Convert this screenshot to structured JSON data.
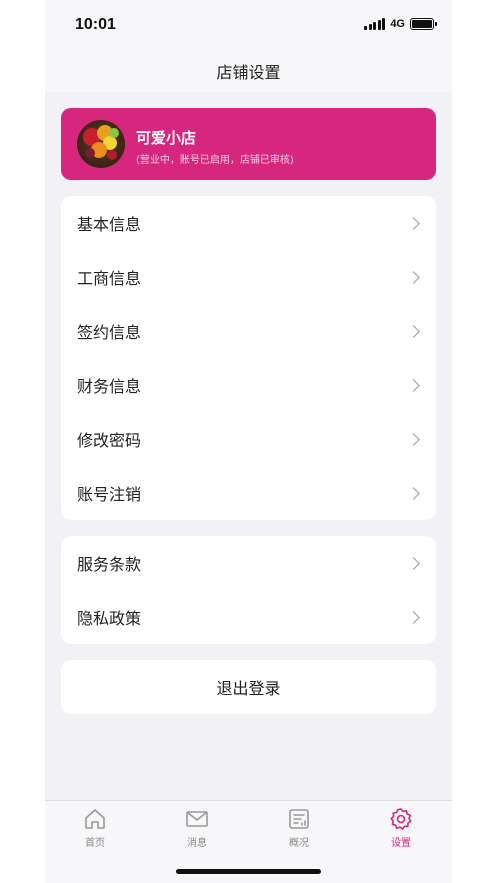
{
  "status_bar": {
    "time": "10:01",
    "network": "4G"
  },
  "header": {
    "title": "店铺设置"
  },
  "shop": {
    "name": "可爱小店",
    "status": "(营业中，账号已启用，店铺已审核)",
    "card_color": "#d6267d"
  },
  "menu_group_1": [
    {
      "label": "基本信息"
    },
    {
      "label": "工商信息"
    },
    {
      "label": "签约信息"
    },
    {
      "label": "财务信息"
    },
    {
      "label": "修改密码"
    },
    {
      "label": "账号注销"
    }
  ],
  "menu_group_2": [
    {
      "label": "服务条款"
    },
    {
      "label": "隐私政策"
    }
  ],
  "logout": {
    "label": "退出登录"
  },
  "tabs": [
    {
      "label": "首页",
      "icon": "home-icon",
      "active": false
    },
    {
      "label": "消息",
      "icon": "mail-icon",
      "active": false
    },
    {
      "label": "概况",
      "icon": "overview-icon",
      "active": false
    },
    {
      "label": "设置",
      "icon": "gear-icon",
      "active": true
    }
  ],
  "colors": {
    "accent": "#d6267d",
    "background": "#f1f1f6"
  }
}
